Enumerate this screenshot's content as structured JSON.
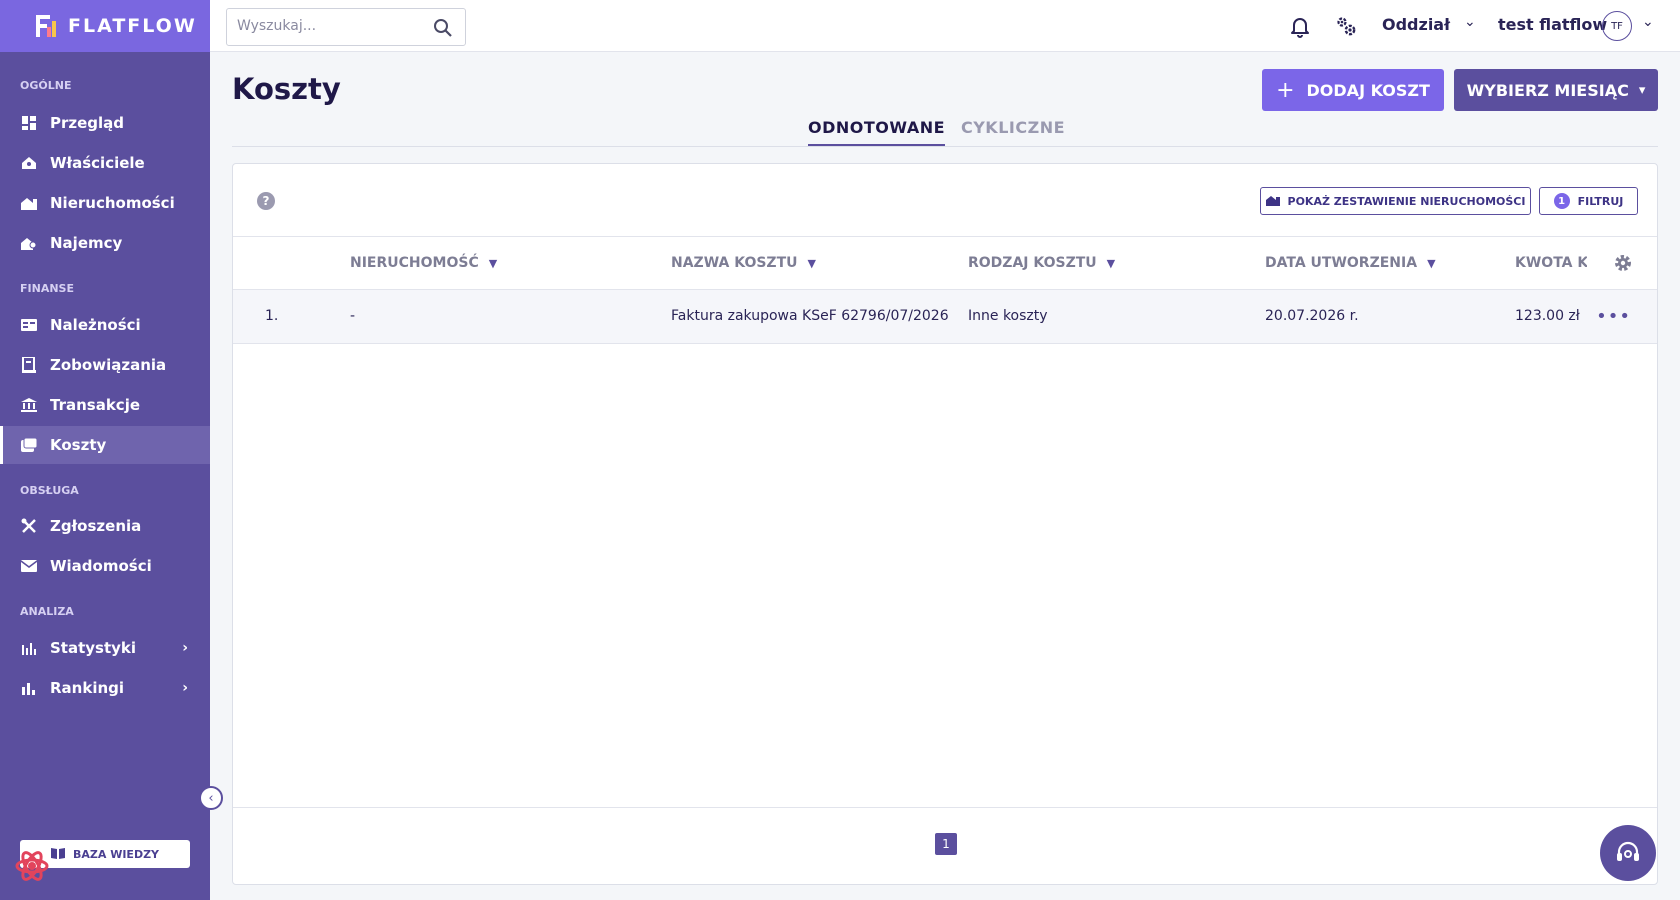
{
  "brand": {
    "name": "FLATFLOW"
  },
  "sidebar": {
    "sections": [
      {
        "label": "OGÓLNE"
      },
      {
        "label": "FINANSE"
      },
      {
        "label": "OBSŁUGA"
      },
      {
        "label": "ANALIZA"
      }
    ],
    "items": [
      {
        "label": "Przegląd",
        "icon": "dashboard-icon"
      },
      {
        "label": "Właściciele",
        "icon": "owners-icon"
      },
      {
        "label": "Nieruchomości",
        "icon": "properties-icon"
      },
      {
        "label": "Najemcy",
        "icon": "tenants-icon"
      },
      {
        "label": "Należności",
        "icon": "receivables-icon"
      },
      {
        "label": "Zobowiązania",
        "icon": "liabilities-icon"
      },
      {
        "label": "Transakcje",
        "icon": "bank-icon"
      },
      {
        "label": "Koszty",
        "icon": "costs-icon",
        "active": true
      },
      {
        "label": "Zgłoszenia",
        "icon": "tools-icon"
      },
      {
        "label": "Wiadomości",
        "icon": "mail-icon"
      },
      {
        "label": "Statystyki",
        "icon": "stats-icon"
      },
      {
        "label": "Rankingi",
        "icon": "ranking-icon"
      }
    ],
    "knowledge_base": "BAZA WIEDZY"
  },
  "header": {
    "search_placeholder": "Wyszukaj...",
    "branch": "Oddział",
    "user_name": "test flatflow",
    "user_initials": "TF"
  },
  "page": {
    "title": "Koszty",
    "add_button": "DODAJ KOSZT",
    "month_button": "WYBIERZ MIESIĄC",
    "tabs": [
      {
        "label": "ODNOTOWANE",
        "active": true
      },
      {
        "label": "CYKLICZNE",
        "active": false
      }
    ]
  },
  "toolbar": {
    "summary_button": "POKAŻ ZESTAWIENIE NIERUCHOMOŚCI",
    "filter_button": "FILTRUJ",
    "filter_count": "1"
  },
  "table": {
    "columns": [
      "NIERUCHOMOŚĆ",
      "NAZWA KOSZTU",
      "RODZAJ KOSZTU",
      "DATA UTWORZENIA",
      "KWOTA KOSZTU"
    ],
    "rows": [
      {
        "index": "1.",
        "property": "-",
        "name": "Faktura zakupowa KSeF 62796/07/2026",
        "type": "Inne koszty",
        "date": "20.07.2026 r.",
        "amount": "123.00 zł"
      }
    ]
  },
  "pagination": {
    "current": "1"
  },
  "colors": {
    "sidebar": "#5b4f9e",
    "accent": "#7b66e8",
    "logo_bg": "#7a67e0"
  }
}
